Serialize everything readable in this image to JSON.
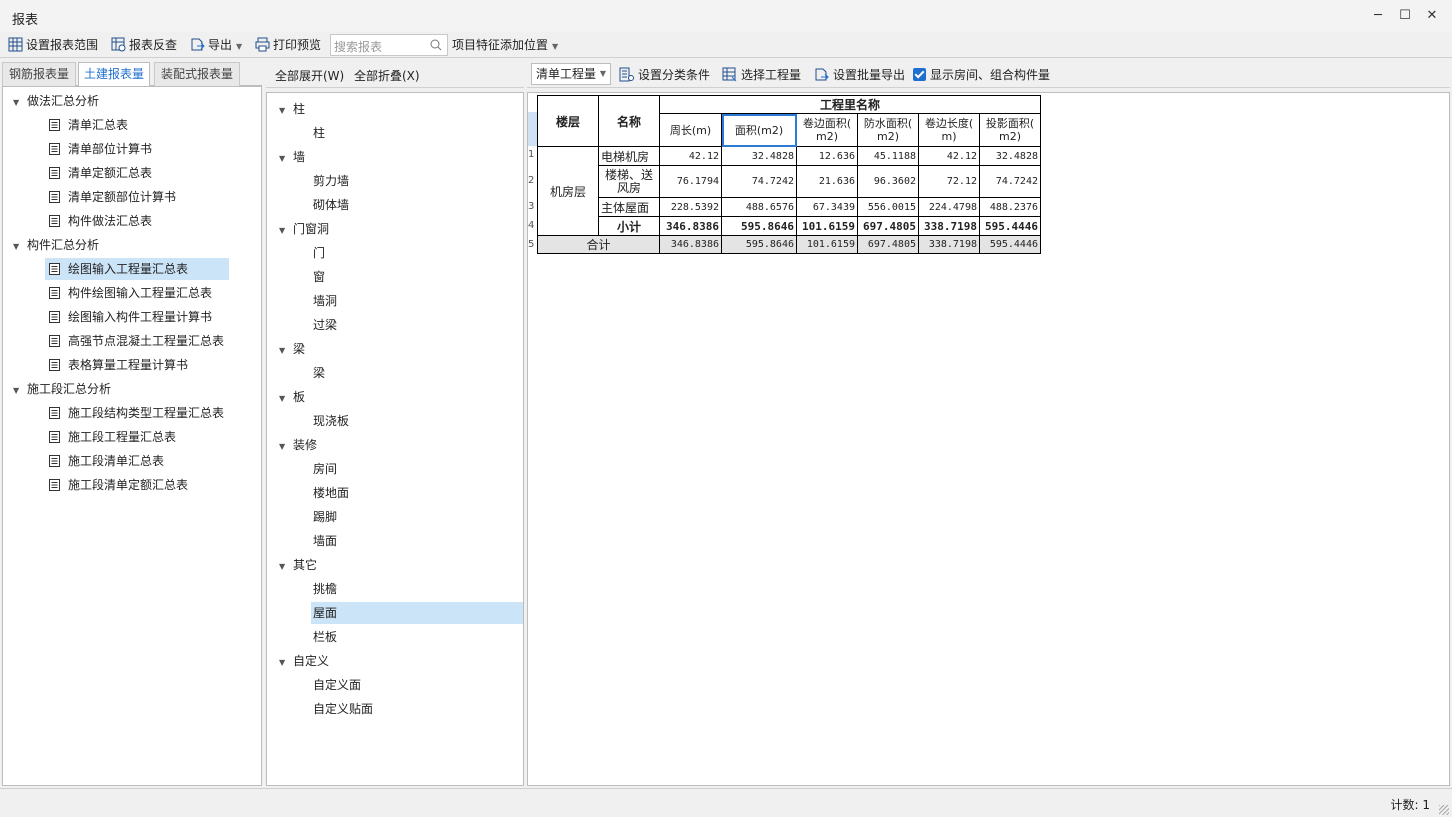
{
  "window": {
    "title": "报表",
    "controls": [
      "minimize",
      "maximize",
      "close"
    ]
  },
  "toolbar": {
    "set_range": "设置报表范围",
    "reverse_check": "报表反查",
    "export": "导出",
    "print_preview": "打印预览",
    "search_placeholder": "搜索报表",
    "feature_position": "项目特征添加位置"
  },
  "left": {
    "tabs": [
      {
        "label": "钢筋报表量",
        "active": false
      },
      {
        "label": "土建报表量",
        "active": true
      },
      {
        "label": "装配式报表量",
        "active": false
      }
    ],
    "groups": [
      {
        "label": "做法汇总分析",
        "items": [
          "清单汇总表",
          "清单部位计算书",
          "清单定额汇总表",
          "清单定额部位计算书",
          "构件做法汇总表"
        ]
      },
      {
        "label": "构件汇总分析",
        "items": [
          "绘图输入工程量汇总表",
          "构件绘图输入工程量汇总表",
          "绘图输入构件工程量计算书",
          "高强节点混凝土工程量汇总表",
          "表格算量工程量计算书"
        ]
      },
      {
        "label": "施工段汇总分析",
        "items": [
          "施工段结构类型工程量汇总表",
          "施工段工程量汇总表",
          "施工段清单汇总表",
          "施工段清单定额汇总表"
        ]
      }
    ],
    "selected": "绘图输入工程量汇总表"
  },
  "middle": {
    "expand_all": "全部展开(W)",
    "collapse_all": "全部折叠(X)",
    "groups": [
      {
        "label": "柱",
        "items": [
          "柱"
        ]
      },
      {
        "label": "墙",
        "items": [
          "剪力墙",
          "砌体墙"
        ]
      },
      {
        "label": "门窗洞",
        "items": [
          "门",
          "窗",
          "墙洞",
          "过梁"
        ]
      },
      {
        "label": "梁",
        "items": [
          "梁"
        ]
      },
      {
        "label": "板",
        "items": [
          "现浇板"
        ]
      },
      {
        "label": "装修",
        "items": [
          "房间",
          "楼地面",
          "踢脚",
          "墙面"
        ]
      },
      {
        "label": "其它",
        "items": [
          "挑檐",
          "屋面",
          "栏板"
        ]
      },
      {
        "label": "自定义",
        "items": [
          "自定义面",
          "自定义贴面"
        ]
      }
    ],
    "selected": "屋面"
  },
  "right": {
    "dropdown": "清单工程量",
    "set_classify": "设置分类条件",
    "select_qty": "选择工程量",
    "batch_export": "设置批量导出",
    "show_rooms": "显示房间、组合构件量",
    "show_rooms_checked": true
  },
  "report": {
    "h_floor": "楼层",
    "h_name": "名称",
    "h_group": "工程里名称",
    "cols": [
      "周长(m)",
      "面积(m2)",
      "卷边面积(\nm2)",
      "防水面积(\nm2)",
      "卷边长度(\nm)",
      "投影面积(\nm2)"
    ],
    "floor": "机房层",
    "row_numbers": [
      "1",
      "2",
      "3",
      "4",
      "5"
    ],
    "rows": [
      {
        "name": "电梯机房",
        "values": [
          "42.12",
          "32.4828",
          "12.636",
          "45.1188",
          "42.12",
          "32.4828"
        ]
      },
      {
        "name": "楼梯、送风房",
        "values": [
          "76.1794",
          "74.7242",
          "21.636",
          "96.3602",
          "72.12",
          "74.7242"
        ]
      },
      {
        "name": "主体屋面",
        "values": [
          "228.5392",
          "488.6576",
          "67.3439",
          "556.0015",
          "224.4798",
          "488.2376"
        ]
      }
    ],
    "subtotal": {
      "label": "小计",
      "values": [
        "346.8386",
        "595.8646",
        "101.6159",
        "697.4805",
        "338.7198",
        "595.4446"
      ]
    },
    "total": {
      "label": "合计",
      "values": [
        "346.8386",
        "595.8646",
        "101.6159",
        "697.4805",
        "338.7198",
        "595.4446"
      ]
    }
  },
  "status": {
    "count_text": "计数: 1"
  }
}
